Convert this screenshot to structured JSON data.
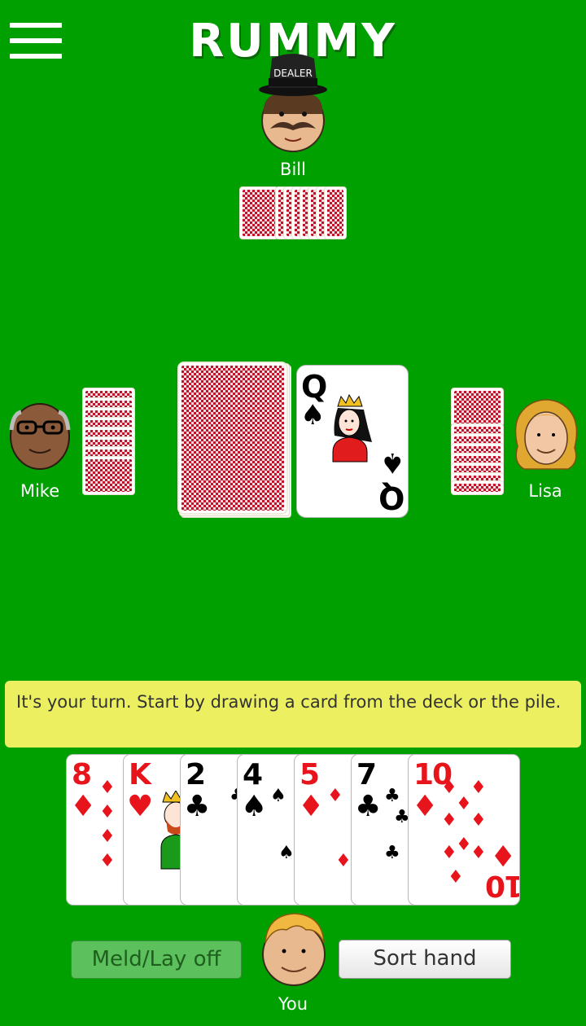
{
  "header": {
    "title": "RUMMY",
    "menu_icon": "hamburger-menu-icon"
  },
  "players": {
    "top": {
      "name": "Bill",
      "badge": "DEALER",
      "cards_in_hand": 10
    },
    "left": {
      "name": "Mike",
      "cards_in_hand": 10
    },
    "right": {
      "name": "Lisa",
      "cards_in_hand": 10
    },
    "bottom": {
      "name": "You"
    }
  },
  "table": {
    "deck": {
      "face": "down"
    },
    "discard": {
      "rank": "Q",
      "suit": "♠",
      "color": "black"
    }
  },
  "message": "It's your turn. Start by drawing a card from the deck or the pile.",
  "hand": [
    {
      "rank": "8",
      "suit": "♦",
      "color": "red"
    },
    {
      "rank": "K",
      "suit": "♥",
      "color": "red"
    },
    {
      "rank": "2",
      "suit": "♣",
      "color": "black"
    },
    {
      "rank": "4",
      "suit": "♠",
      "color": "black"
    },
    {
      "rank": "5",
      "suit": "♦",
      "color": "red"
    },
    {
      "rank": "7",
      "suit": "♣",
      "color": "black"
    },
    {
      "rank": "10",
      "suit": "♦",
      "color": "red"
    }
  ],
  "buttons": {
    "meld": "Meld/Lay off",
    "sort": "Sort hand"
  },
  "colors": {
    "felt": "#00a000",
    "message_bg": "#ecf060",
    "card_red": "#e8141c"
  }
}
